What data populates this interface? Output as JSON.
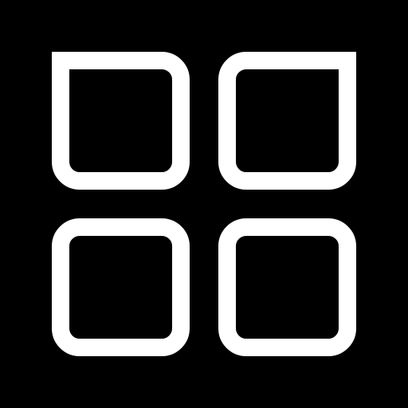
{
  "icon": {
    "name": "app-grid-icon",
    "shape": "2x2 grid of rounded squares (outlined)",
    "stroke_color": "#ffffff",
    "background_color": "#000000"
  }
}
